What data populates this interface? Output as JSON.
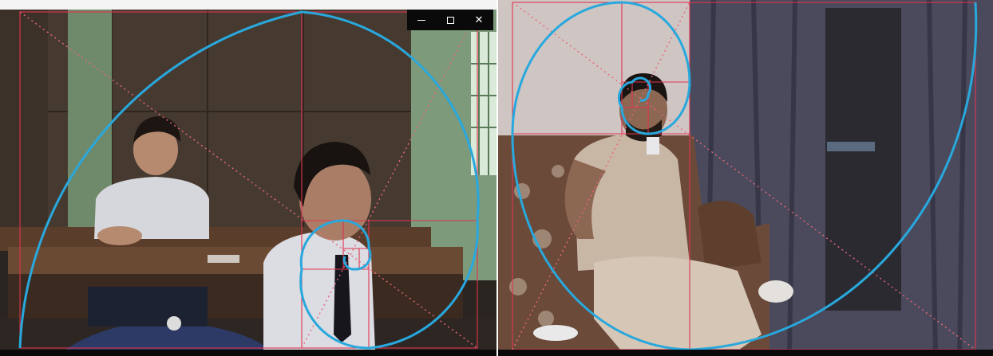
{
  "window": {
    "minimize_symbol": "–",
    "maximize_symbol": "☐",
    "close_symbol": "✕"
  },
  "overlay": {
    "spiral_color": "#29a8dd",
    "grid_color": "#e0344f",
    "diagonal_color": "#e8667a"
  },
  "panels": [
    {
      "id": "left",
      "subject": "classroom-scene"
    },
    {
      "id": "right",
      "subject": "man-drinking-on-sofa"
    }
  ]
}
